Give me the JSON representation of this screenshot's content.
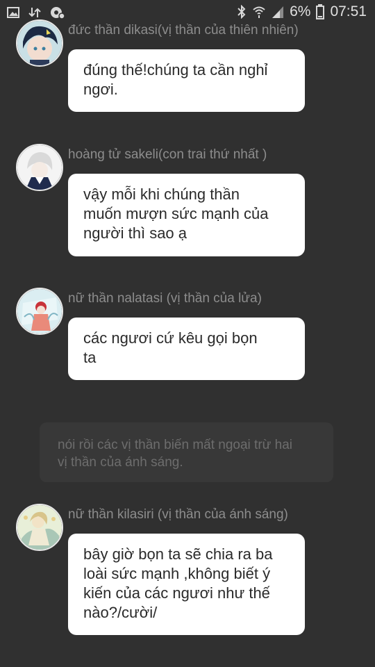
{
  "status_bar": {
    "battery_percent": "6%",
    "time": "07:51",
    "icons": [
      "image-icon",
      "data-transfer-icon",
      "settings-icon",
      "bluetooth-icon",
      "wifi-icon",
      "signal-icon",
      "battery-icon"
    ]
  },
  "messages": [
    {
      "sender": "đức thần dikasi(vị thần của thiên nhiên)",
      "text": "đúng thế!chúng ta cần nghỉ\nngơi."
    },
    {
      "sender": "hoàng tử sakeli(con trai thứ nhất )",
      "text": "vậy mỗi khi chúng thần\nmuốn mượn sức mạnh của\nngười thì sao ạ"
    },
    {
      "sender": "nữ thần nalatasi (vị thần của lửa)",
      "text": "các ngươi cứ kêu gọi bọn\nta"
    },
    {
      "sender": "nữ thần kilasiri  (vị thần của ánh sáng)",
      "text": "bây giờ bọn ta sẽ chia ra ba\nloài sức mạnh ,không biết ý\nkiến của các ngươi như thế\nnào?/cười/"
    }
  ],
  "narration": {
    "text": "nói rồi các vị thần biến mất ngoại trừ hai\nvị thần của ánh sáng."
  },
  "colors": {
    "background": "#303030",
    "bubble": "#ffffff",
    "sender_text": "#8d8d8d",
    "narration_bg": "#383838",
    "narration_text": "#6d6d6d"
  }
}
